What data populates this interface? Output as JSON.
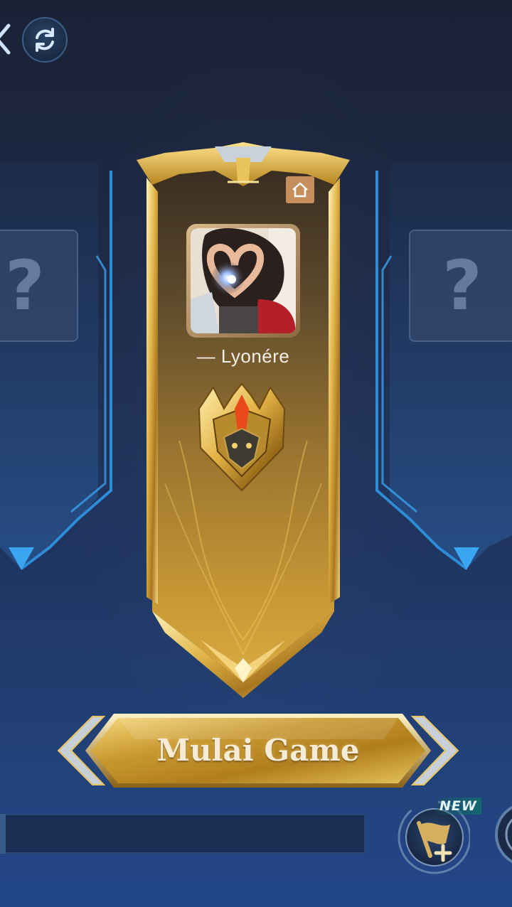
{
  "lobby": {
    "player": {
      "name": "— Lyonére"
    },
    "start_button": {
      "label": "Mulai Game"
    },
    "badge": {
      "new_label": "NEW"
    },
    "empty_slots": {
      "left_symbol": "?",
      "right_symbol": "?"
    }
  },
  "icons": {
    "back": "chevron-left-icon",
    "refresh": "refresh-icon",
    "home": "home-icon",
    "rank": "rank-emblem-icon",
    "squad": "flag-plus-icon"
  },
  "colors": {
    "gold": "#d4a437",
    "blue_accent": "#2d8fd8",
    "background": "#1f3560"
  }
}
